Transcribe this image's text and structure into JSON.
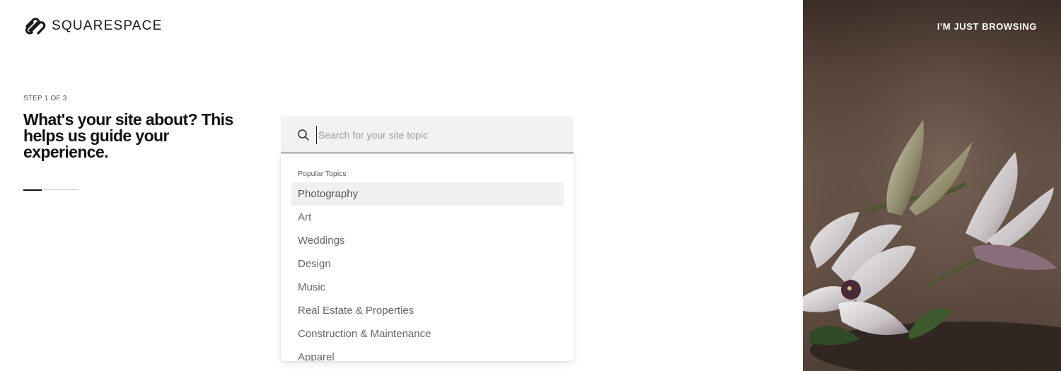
{
  "brand": {
    "name": "SQUARESPACE",
    "icon": "squarespace-logo-icon"
  },
  "onboarding": {
    "step_label": "STEP 1 OF 3",
    "headline": "What's your site about? This helps us guide your experience.",
    "progress": 0.33
  },
  "search": {
    "placeholder": "Search for your site topic",
    "value": "",
    "icon": "search-icon"
  },
  "dropdown": {
    "heading": "Popular Topics",
    "items": [
      {
        "label": "Photography",
        "active": true
      },
      {
        "label": "Art"
      },
      {
        "label": "Weddings"
      },
      {
        "label": "Design"
      },
      {
        "label": "Music"
      },
      {
        "label": "Real Estate & Properties"
      },
      {
        "label": "Construction & Maintenance"
      },
      {
        "label": "Apparel"
      }
    ]
  },
  "hero": {
    "browse_label": "I'M JUST BROWSING",
    "image": "lily-flowers-photo",
    "colors": {
      "background": "#5e4a3f",
      "text": "#ffffff"
    }
  }
}
